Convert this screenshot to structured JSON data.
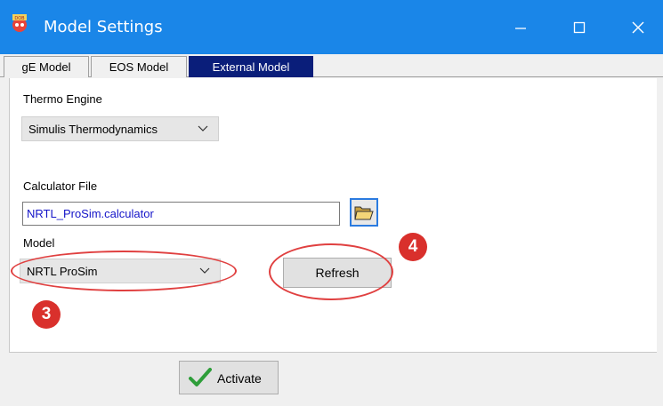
{
  "window": {
    "title": "Model Settings",
    "controls": {
      "minimize": "minimize-icon",
      "maximize": "maximize-icon",
      "close": "close-icon"
    }
  },
  "tabs": [
    {
      "label": "gE Model",
      "selected": false
    },
    {
      "label": "EOS Model",
      "selected": false
    },
    {
      "label": "External Model",
      "selected": true
    }
  ],
  "thermo_engine": {
    "label": "Thermo Engine",
    "value": "Simulis Thermodynamics"
  },
  "calculator_file": {
    "label": "Calculator File",
    "value": "NRTL_ProSim.calculator",
    "browse_icon": "folder-open-icon"
  },
  "model": {
    "label": "Model",
    "value": "NRTL ProSim"
  },
  "buttons": {
    "refresh": "Refresh",
    "activate": "Activate"
  },
  "annotations": {
    "step_model": "3",
    "step_refresh": "4"
  },
  "colors": {
    "titlebar": "#1a86e8",
    "selected_tab": "#0a1e7a",
    "callout": "#e04040",
    "badge": "#d9302c",
    "file_text": "#1414c8"
  }
}
